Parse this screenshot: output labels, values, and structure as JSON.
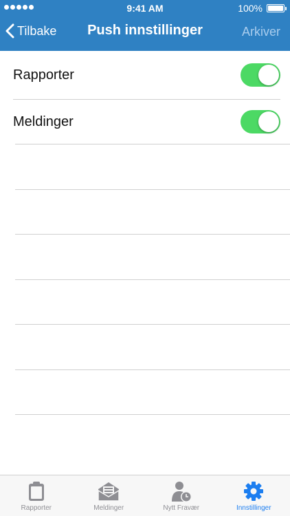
{
  "status_bar": {
    "time": "9:41 AM",
    "battery": "100%"
  },
  "nav": {
    "back_label": "Tilbake",
    "title": "Push innstillinger",
    "archive_label": "Arkiver"
  },
  "settings": [
    {
      "label": "Rapporter",
      "enabled": true
    },
    {
      "label": "Meldinger",
      "enabled": true
    }
  ],
  "tabs": [
    {
      "label": "Rapporter",
      "icon": "clipboard-icon",
      "active": false
    },
    {
      "label": "Meldinger",
      "icon": "envelope-icon",
      "active": false
    },
    {
      "label": "Nytt Fravær",
      "icon": "person-clock-icon",
      "active": false
    },
    {
      "label": "Innstillinger",
      "icon": "gear-icon",
      "active": true
    }
  ],
  "colors": {
    "header": "#2f81c3",
    "switch_on": "#4cd964",
    "tab_active": "#1c7ef0",
    "tab_inactive": "#8e8e93"
  }
}
